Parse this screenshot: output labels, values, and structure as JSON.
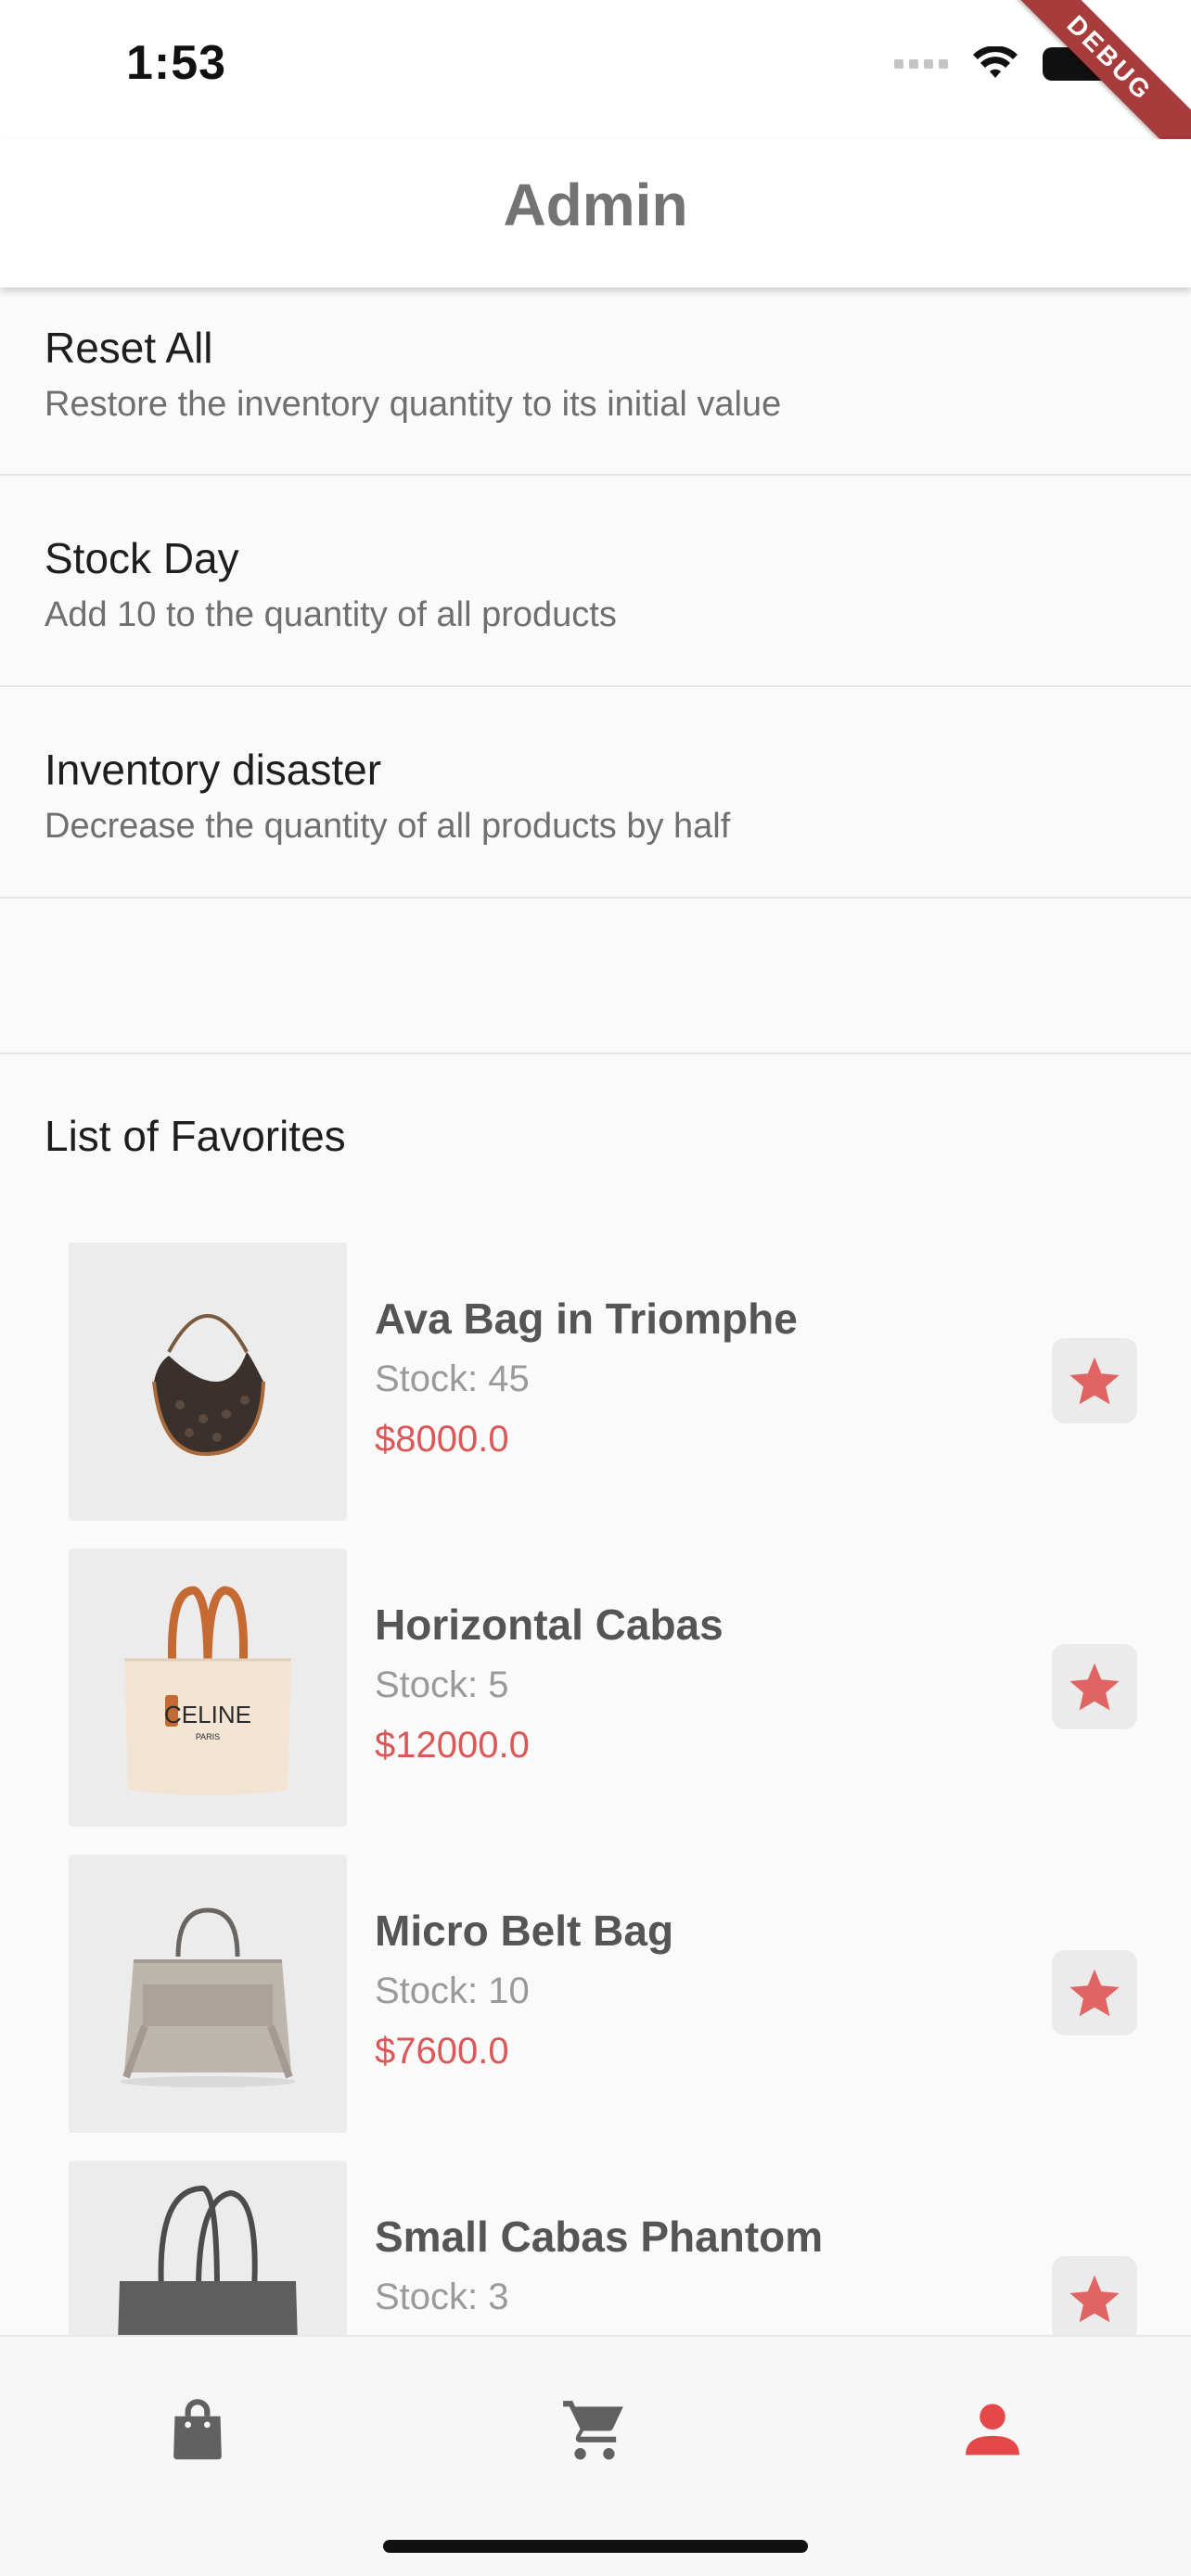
{
  "status_bar": {
    "time": "1:53"
  },
  "debug_banner": "DEBUG",
  "app_bar": {
    "title": "Admin"
  },
  "actions": [
    {
      "title": "Reset All",
      "subtitle": "Restore the inventory quantity to its initial value"
    },
    {
      "title": "Stock Day",
      "subtitle": "Add 10 to the quantity of all products"
    },
    {
      "title": "Inventory disaster",
      "subtitle": "Decrease the quantity of all products by half"
    }
  ],
  "favorites": {
    "heading": "List of Favorites",
    "items": [
      {
        "name": "Ava Bag in Triomphe",
        "stock": "Stock: 45",
        "price": "$8000.0",
        "image": "ava-bag-image"
      },
      {
        "name": "Horizontal Cabas",
        "stock": "Stock: 5",
        "price": "$12000.0",
        "image": "horizontal-cabas-image",
        "brand_text": "CELINE",
        "brand_sub": "PARIS"
      },
      {
        "name": "Micro Belt Bag",
        "stock": "Stock: 10",
        "price": "$7600.0",
        "image": "micro-belt-bag-image"
      },
      {
        "name": "Small Cabas Phantom",
        "stock": "Stock: 3",
        "price": "",
        "image": "small-cabas-phantom-image"
      }
    ]
  },
  "bottom_nav": [
    {
      "icon": "shopping-bag-icon",
      "active": false
    },
    {
      "icon": "cart-icon",
      "active": false
    },
    {
      "icon": "person-icon",
      "active": true
    }
  ],
  "colors": {
    "accent": "#e54848",
    "price": "#dc5757",
    "star": "#e06464",
    "nav_inactive": "#616161"
  }
}
